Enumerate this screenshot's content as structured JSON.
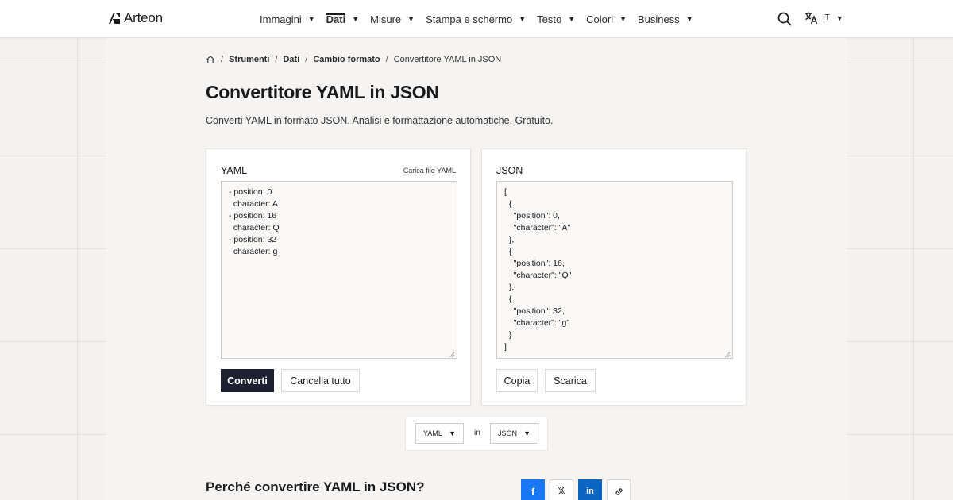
{
  "brand": {
    "name": "Arteon"
  },
  "nav": {
    "items": [
      {
        "label": "Immagini",
        "active": false
      },
      {
        "label": "Dati",
        "active": true
      },
      {
        "label": "Misure",
        "active": false
      },
      {
        "label": "Stampa e schermo",
        "active": false
      },
      {
        "label": "Testo",
        "active": false
      },
      {
        "label": "Colori",
        "active": false
      },
      {
        "label": "Business",
        "active": false
      }
    ],
    "language": "IT"
  },
  "breadcrumb": {
    "items": [
      "Strumenti",
      "Dati",
      "Cambio formato"
    ],
    "current": "Convertitore YAML in JSON"
  },
  "page": {
    "title": "Convertitore YAML in JSON",
    "subtitle": "Converti YAML in formato JSON. Analisi e formattazione automatiche. Gratuito."
  },
  "input_panel": {
    "label": "YAML",
    "upload_label": "Carica file YAML",
    "value": "- position: 0\n  character: A\n- position: 16\n  character: Q\n- position: 32\n  character: g",
    "convert_label": "Converti",
    "clear_label": "Cancella tutto"
  },
  "output_panel": {
    "label": "JSON",
    "value": "[\n  {\n    \"position\": 0,\n    \"character\": \"A\"\n  },\n  {\n    \"position\": 16,\n    \"character\": \"Q\"\n  },\n  {\n    \"position\": 32,\n    \"character\": \"g\"\n  }\n]",
    "copy_label": "Copia",
    "download_label": "Scarica"
  },
  "format_switch": {
    "from": "YAML",
    "connector": "in",
    "to": "JSON"
  },
  "section": {
    "title": "Perché convertire YAML in JSON?"
  },
  "share": {
    "facebook_glyph": "f",
    "x_glyph": "𝕏",
    "linkedin_glyph": "in"
  },
  "colors": {
    "primary_button": "#1c2030",
    "facebook": "#1877f2",
    "linkedin": "#0a66c2"
  }
}
